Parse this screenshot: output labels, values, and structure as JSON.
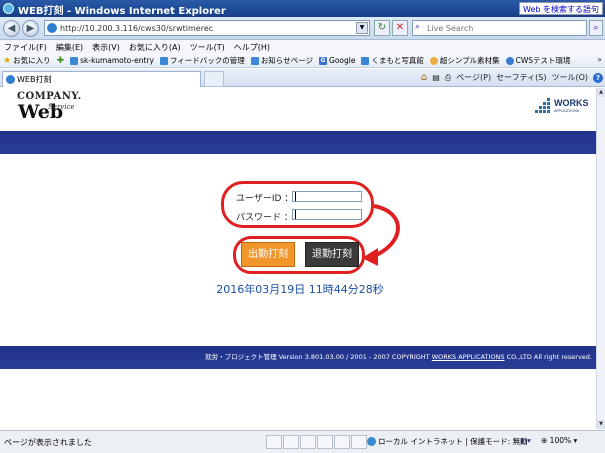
{
  "window": {
    "title": "WEB打刻 - Windows Internet Explorer",
    "title_right_button": "Web を検索する語句"
  },
  "addressbar": {
    "url": "http://10.200.3.116/cws30/srwtimerec",
    "search_placeholder": "Live Search"
  },
  "menubar": {
    "items": [
      "ファイル(F)",
      "編集(E)",
      "表示(V)",
      "お気に入り(A)",
      "ツール(T)",
      "ヘルプ(H)"
    ]
  },
  "favorites": {
    "label": "お気に入り",
    "items": [
      "sk-kumamoto-entry",
      "フィードバックの管理",
      "お知らせページ",
      "Google",
      "くまもと写真館",
      "超シンプル素材集",
      "CWSテスト環境"
    ]
  },
  "tab": {
    "label": "WEB打刻"
  },
  "commandbar": {
    "page": "ページ(P)",
    "safety": "セーフティ(S)",
    "tools": "ツール(O)"
  },
  "page": {
    "logo_company": "COMPANY.",
    "logo_web": "Web",
    "logo_service": "Service",
    "works_name": "WORKS",
    "works_sub": "APPLICATIONS",
    "user_id_label": "ユーザーID ：",
    "password_label": "パスワード ：",
    "clock_in": "出勤打刻",
    "clock_out": "退勤打刻",
    "datetime": "2016年03月19日 11時44分28秒",
    "footer_prefix": "就労・プロジェクト管理 Version 3.801.03.00 / 2001 - 2007 COPYRIGHT ",
    "footer_link": "WORKS APPLICATIONS",
    "footer_suffix": " CO.,LTD All right reserved."
  },
  "statusbar": {
    "text": "ページが表示されました",
    "zone": "ローカル イントラネット | 保護モード: 無効",
    "zoom": "100%"
  },
  "colors": {
    "band": "#2a3d96",
    "clock_in_bg": "#f0962a",
    "clock_out_bg": "#3a3a3a",
    "highlight": "#e02020",
    "datetime": "#1b4fa0"
  }
}
